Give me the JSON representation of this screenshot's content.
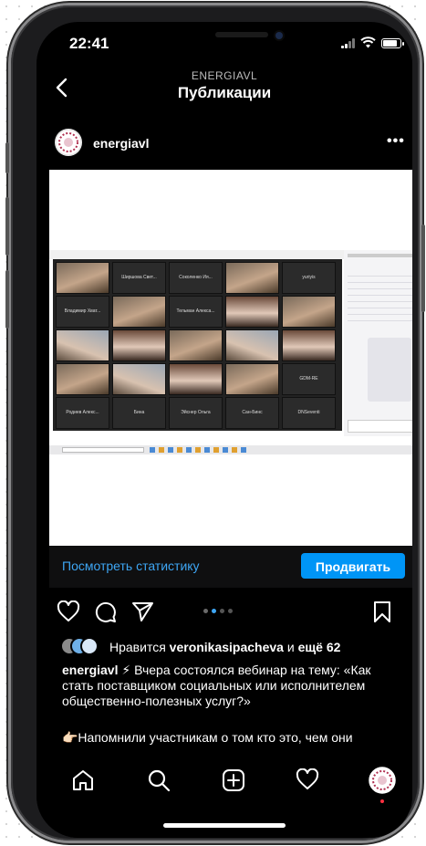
{
  "status": {
    "time": "22:41"
  },
  "header": {
    "account": "ENERGIAVL",
    "title": "Публикации"
  },
  "post": {
    "username": "energiavl",
    "more_label": "•••",
    "stats_link": "Посмотреть статистику",
    "promote_label": "Продвигать",
    "carousel": {
      "count": 4,
      "active": 1
    },
    "likes": {
      "prefix": "Нравится ",
      "user": "veronikasipacheva",
      "middle": " и ",
      "count_text": "ещё 62"
    },
    "caption_user": "energiavl",
    "caption_text": " ⚡ Вчера состоялся вебинар на тему: «Как стать поставщиком социальных или исполнителем общественно-полезных услуг?»",
    "caption_text2": "👉🏻Напомнили участникам о том кто это, чем они"
  },
  "zoom_tiles": [
    "",
    "Ширшова Свет...",
    "Соколенко Ия...",
    "",
    "yuriyis",
    "Владимир Хват...",
    "",
    "Тельман Алекса...",
    "",
    "",
    "",
    "",
    "",
    "",
    "",
    "",
    "",
    "",
    "",
    "GDM-RE",
    "Родиев Алекс...",
    "Бина",
    "Эйснер Ольга",
    "Сан-Бинс",
    "DNSeventi"
  ],
  "icons": {
    "back": "chevron-left-icon",
    "like": "heart-icon",
    "comment": "comment-icon",
    "share": "send-icon",
    "save": "bookmark-icon",
    "home": "home-icon",
    "search": "search-icon",
    "create": "plus-square-icon",
    "activity": "heart-icon"
  },
  "colors": {
    "link": "#3ea6f4",
    "promote": "#0095f6",
    "active_dot": "#3ea6f4"
  }
}
